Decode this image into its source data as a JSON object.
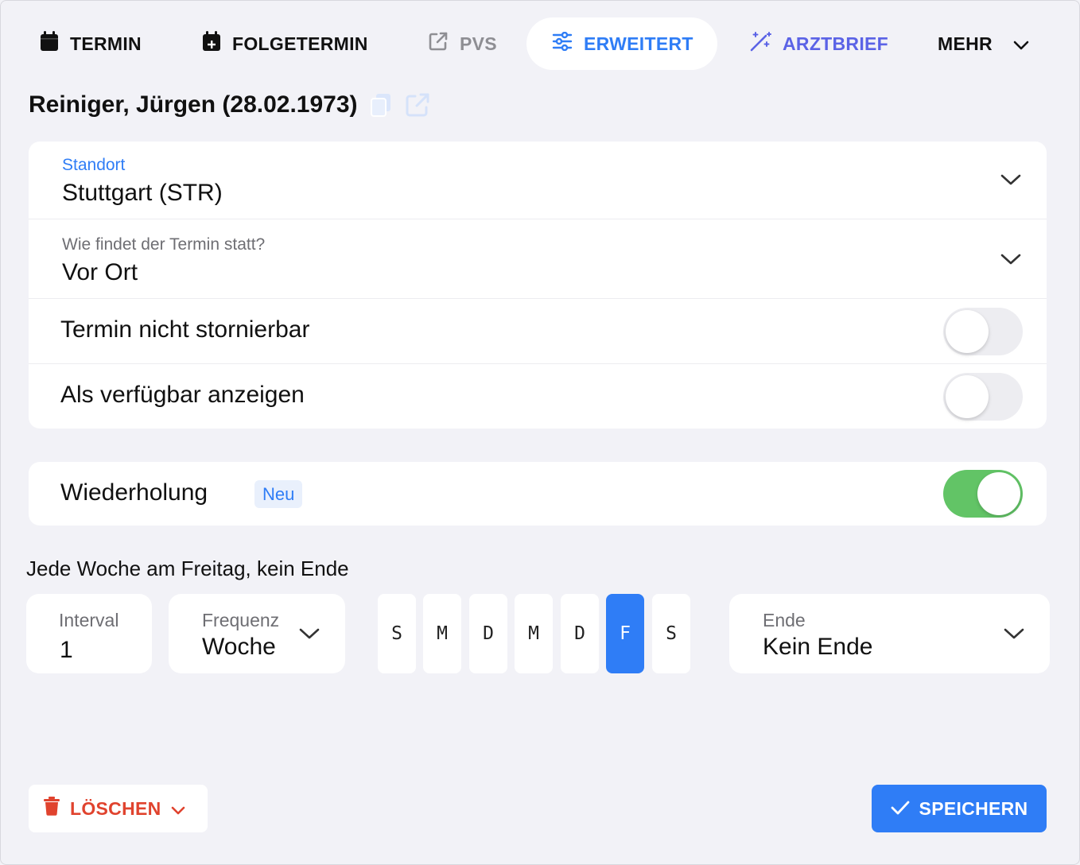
{
  "colors": {
    "accent": "#2f7df6",
    "arztbrief": "#5b63e6",
    "delete": "#e0432e",
    "toggle_on": "#62c466",
    "background": "#f2f2f7"
  },
  "tabs": {
    "termin": {
      "label": "TERMIN",
      "icon": "calendar-icon"
    },
    "folgetermin": {
      "label": "FOLGETERMIN",
      "icon": "calendar-plus-icon"
    },
    "pvs": {
      "label": "PVS",
      "icon": "external-link-icon"
    },
    "erweitert": {
      "label": "ERWEITERT",
      "icon": "sliders-icon",
      "active": true
    },
    "arztbrief": {
      "label": "ARZTBRIEF",
      "icon": "magic-wand-icon"
    },
    "mehr": {
      "label": "MEHR",
      "icon": "chevron-down-icon"
    }
  },
  "patient": {
    "name": "Reiniger, Jürgen (28.02.1973)"
  },
  "form": {
    "standort": {
      "label": "Standort",
      "value": "Stuttgart (STR)"
    },
    "ort": {
      "label": "Wie findet der Termin statt?",
      "value": "Vor Ort"
    },
    "nicht_stornierbar": {
      "label": "Termin nicht stornierbar",
      "on": false
    },
    "verfuegbar": {
      "label": "Als verfügbar anzeigen",
      "on": false
    }
  },
  "wiederholung": {
    "label": "Wiederholung",
    "badge": "Neu",
    "on": true,
    "summary": "Jede Woche am Freitag, kein Ende",
    "interval": {
      "label": "Interval",
      "value": "1"
    },
    "frequenz": {
      "label": "Frequenz",
      "value": "Woche"
    },
    "days": [
      {
        "label": "S",
        "selected": false
      },
      {
        "label": "M",
        "selected": false
      },
      {
        "label": "D",
        "selected": false
      },
      {
        "label": "M",
        "selected": false
      },
      {
        "label": "D",
        "selected": false
      },
      {
        "label": "F",
        "selected": true
      },
      {
        "label": "S",
        "selected": false
      }
    ],
    "ende": {
      "label": "Ende",
      "value": "Kein Ende"
    }
  },
  "footer": {
    "delete_label": "LÖSCHEN",
    "save_label": "SPEICHERN"
  }
}
